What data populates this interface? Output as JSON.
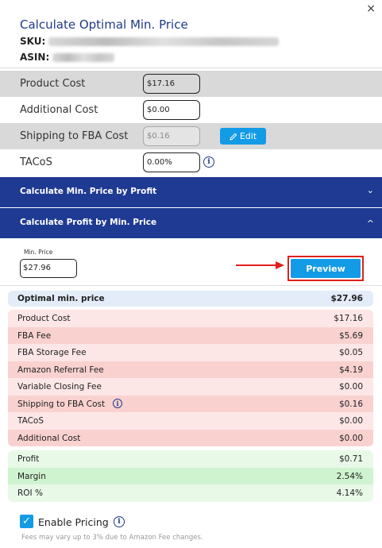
{
  "header": {
    "close_icon": "×",
    "title": "Calculate Optimal Min. Price",
    "sku_label": "SKU:",
    "asin_label": "ASIN:"
  },
  "cost_fields": {
    "product_cost": {
      "label": "Product Cost",
      "value": "$17.16"
    },
    "additional_cost": {
      "label": "Additional Cost",
      "value": "$0.00"
    },
    "shipping": {
      "label": "Shipping to FBA Cost",
      "value": "$0.16",
      "edit_label": "Edit"
    },
    "tacos": {
      "label": "TACoS",
      "value": "0.00%"
    }
  },
  "sections": {
    "by_profit": {
      "label": "Calculate Min. Price by Profit",
      "chevron": "⌄"
    },
    "by_min_price": {
      "label": "Calculate Profit by Min. Price",
      "chevron": "^"
    }
  },
  "min_price": {
    "label": "Min. Price",
    "value": "$27.96",
    "preview_label": "Preview"
  },
  "optimal": {
    "label": "Optimal min. price",
    "value": "$27.96"
  },
  "costs_breakdown": [
    {
      "label": "Product Cost",
      "value": "$17.16"
    },
    {
      "label": "FBA Fee",
      "value": "$5.69"
    },
    {
      "label": "FBA Storage Fee",
      "value": "$0.05"
    },
    {
      "label": "Amazon Referral Fee",
      "value": "$4.19"
    },
    {
      "label": "Variable Closing Fee",
      "value": "$0.00"
    },
    {
      "label": "Shipping to FBA Cost",
      "value": "$0.16"
    },
    {
      "label": "TACoS",
      "value": "$0.00"
    },
    {
      "label": "Additional Cost",
      "value": "$0.00"
    }
  ],
  "results": [
    {
      "label": "Profit",
      "value": "$0.71"
    },
    {
      "label": "Margin",
      "value": "2.54%"
    },
    {
      "label": "ROI %",
      "value": "4.14%"
    }
  ],
  "enable_pricing": {
    "label": "Enable Pricing",
    "checked": true
  },
  "footnote": "Fees may vary up to 3% due to Amazon Fee changes.",
  "colors": {
    "accent": "#139be6",
    "navy": "#1f3a93",
    "highlight": "#e0201a"
  }
}
